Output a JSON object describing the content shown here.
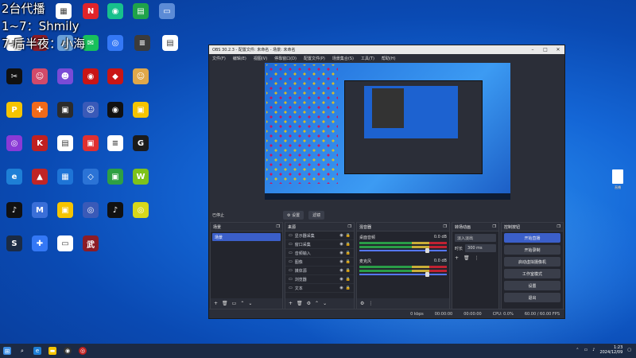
{
  "overlay": {
    "line1": "2台代播",
    "line2": "1~7：Shmily",
    "line3": "7-后半夜：小海"
  },
  "desktop_icons": [
    {
      "color": "#ffffff",
      "glyph": "▦",
      "label": ""
    },
    {
      "color": "#e0242a",
      "glyph": "N",
      "label": ""
    },
    {
      "color": "#17c08c",
      "glyph": "◉",
      "label": ""
    },
    {
      "color": "#1fa34a",
      "glyph": "▤",
      "label": ""
    },
    {
      "color": "#5c8bd6",
      "glyph": "▭",
      "label": ""
    },
    {
      "color": "#3b3b3b",
      "glyph": "≡",
      "label": ""
    },
    {
      "color": "#ffffff",
      "glyph": "▤",
      "label": ""
    },
    {
      "color": "#ffffff",
      "glyph": "≡",
      "label": ""
    },
    {
      "color": "#8c1c26",
      "glyph": "◆",
      "label": ""
    },
    {
      "color": "#6aa0d8",
      "glyph": "▭",
      "label": ""
    },
    {
      "color": "#18c15b",
      "glyph": "✉",
      "label": ""
    },
    {
      "color": "#3478f6",
      "glyph": "◎",
      "label": ""
    },
    {
      "color": "#111111",
      "glyph": "✂",
      "label": ""
    },
    {
      "color": "#d14a6a",
      "glyph": "☺",
      "label": ""
    },
    {
      "color": "#7a4bd6",
      "glyph": "☻",
      "label": ""
    },
    {
      "color": "#c91515",
      "glyph": "◉",
      "label": ""
    },
    {
      "color": "#c91515",
      "glyph": "◆",
      "label": ""
    },
    {
      "color": "#e0a84a",
      "glyph": "☺",
      "label": ""
    },
    {
      "color": "#f5c400",
      "glyph": "P",
      "label": ""
    },
    {
      "color": "#f06a1a",
      "glyph": "✚",
      "label": ""
    },
    {
      "color": "#2c2c2c",
      "glyph": "▣",
      "label": ""
    },
    {
      "color": "#3a5ab8",
      "glyph": "☺",
      "label": ""
    },
    {
      "color": "#111111",
      "glyph": "◉",
      "label": ""
    },
    {
      "color": "#f5c400",
      "glyph": "▣",
      "label": ""
    },
    {
      "color": "#8a3ad6",
      "glyph": "◎",
      "label": ""
    },
    {
      "color": "#c02020",
      "glyph": "K",
      "label": ""
    },
    {
      "color": "#ffffff",
      "glyph": "▤",
      "label": ""
    },
    {
      "color": "#e03030",
      "glyph": "▣",
      "label": ""
    },
    {
      "color": "#ffffff",
      "glyph": "≡",
      "label": ""
    },
    {
      "color": "#1b1b1b",
      "glyph": "G",
      "label": ""
    },
    {
      "color": "#1e7fd6",
      "glyph": "e",
      "label": ""
    },
    {
      "color": "#c02525",
      "glyph": "▲",
      "label": ""
    },
    {
      "color": "#1e74d6",
      "glyph": "▦",
      "label": ""
    },
    {
      "color": "#2b73d6",
      "glyph": "◇",
      "label": ""
    },
    {
      "color": "#2ea043",
      "glyph": "▣",
      "label": ""
    },
    {
      "color": "#7ec21a",
      "glyph": "W",
      "label": ""
    },
    {
      "color": "#111111",
      "glyph": "♪",
      "label": ""
    },
    {
      "color": "#3a6fd8",
      "glyph": "M",
      "label": ""
    },
    {
      "color": "#f5c400",
      "glyph": "▣",
      "label": ""
    },
    {
      "color": "#3a5ab8",
      "glyph": "◎",
      "label": ""
    },
    {
      "color": "#111111",
      "glyph": "♪",
      "label": ""
    },
    {
      "color": "#d8d81a",
      "glyph": "◎",
      "label": ""
    },
    {
      "color": "#1b2b44",
      "glyph": "S",
      "label": ""
    },
    {
      "color": "#3478f6",
      "glyph": "✚",
      "label": ""
    },
    {
      "color": "#ffffff",
      "glyph": "▭",
      "label": ""
    },
    {
      "color": "#8c1c26",
      "glyph": "武",
      "label": ""
    }
  ],
  "obs": {
    "title": "OBS 30.2.3 - 配置文件: 未命名 - 场景: 未命名",
    "menus": [
      "文件(F)",
      "编辑(E)",
      "视图(V)",
      "停靠窗口(D)",
      "配置文件(P)",
      "场景集合(S)",
      "工具(T)",
      "帮助(H)"
    ],
    "strip": {
      "label": "已停止",
      "btn1": "⚙ 设置",
      "btn2": "滤镜"
    },
    "scenes": {
      "title": "场景",
      "items": [
        "场景"
      ]
    },
    "sources": {
      "title": "来源",
      "items": [
        "显示器采集",
        "窗口采集",
        "音频输入",
        "图像",
        "媒体源",
        "浏览器",
        "文本"
      ]
    },
    "mixer": {
      "title": "混音器",
      "ch1": {
        "name": "桌面音频",
        "db": "0.0 dB"
      },
      "ch2": {
        "name": "麦克风",
        "db": "0.0 dB"
      }
    },
    "transitions": {
      "title": "转场动画",
      "type": "淡入淡出",
      "dur_label": "时长",
      "dur": "300 ms"
    },
    "controls": {
      "title": "控制按钮",
      "buttons": [
        "开始直播",
        "开始录制",
        "启动虚拟摄像机",
        "工作室模式",
        "设置",
        "退出"
      ]
    },
    "status": [
      "0 kbps",
      "00:00:00",
      "00:00:00",
      "CPU: 0.0%",
      "60.00 / 60.00 FPS"
    ]
  },
  "right_file_label": "直播",
  "taskbar": {
    "time": "1:23",
    "date": "2024/12/09"
  }
}
